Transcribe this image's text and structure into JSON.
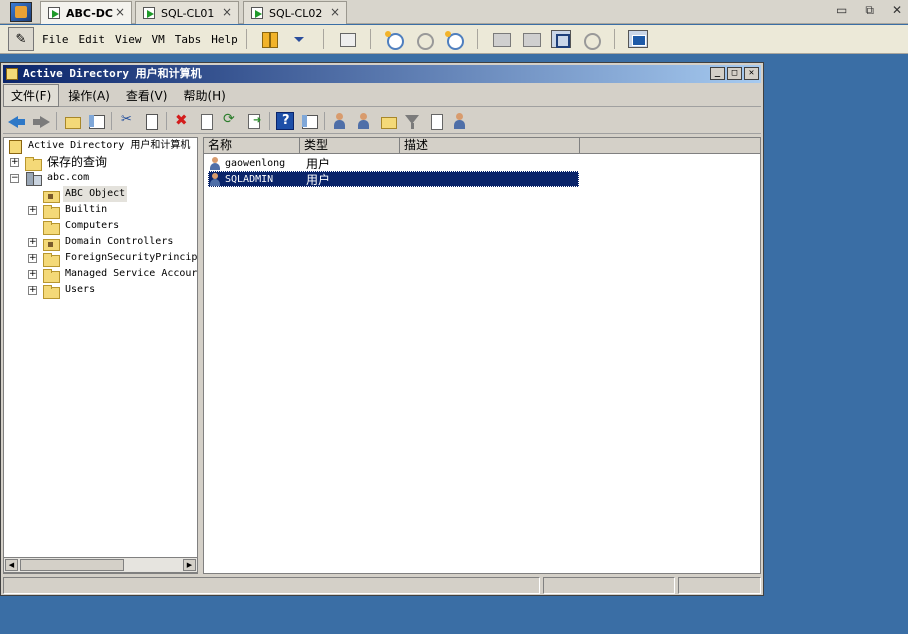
{
  "host": {
    "tabs": [
      {
        "label": "ABC-DC",
        "active": true
      },
      {
        "label": "SQL-CL01",
        "active": false
      },
      {
        "label": "SQL-CL02",
        "active": false
      }
    ],
    "tab_close_glyph": "×",
    "window_controls": [
      "▭",
      "⧉",
      "✕"
    ],
    "menu": [
      "File",
      "Edit",
      "View",
      "VM",
      "Tabs",
      "Help"
    ]
  },
  "mmc": {
    "title": "Active Directory 用户和计算机",
    "window_controls": [
      "_",
      "□",
      "✕"
    ],
    "menu": [
      {
        "label": "文件(F)",
        "open": true
      },
      {
        "label": "操作(A)",
        "open": false
      },
      {
        "label": "查看(V)",
        "open": false
      },
      {
        "label": "帮助(H)",
        "open": false
      }
    ]
  },
  "tree": {
    "root": "Active Directory 用户和计算机",
    "items": [
      {
        "label": "保存的查询",
        "expander": "+",
        "icon": "folder-icon",
        "depth": 0
      },
      {
        "label": "abc.com",
        "expander": "−",
        "icon": "domain-icon",
        "depth": 0
      },
      {
        "label": "ABC Object",
        "expander": "",
        "icon": "ou-icon",
        "depth": 1,
        "selected": true
      },
      {
        "label": "Builtin",
        "expander": "+",
        "icon": "folder-icon",
        "depth": 1
      },
      {
        "label": "Computers",
        "expander": "",
        "icon": "folder-icon",
        "depth": 1
      },
      {
        "label": "Domain Controllers",
        "expander": "+",
        "icon": "ou-icon",
        "depth": 1
      },
      {
        "label": "ForeignSecurityPrincip",
        "expander": "+",
        "icon": "folder-icon",
        "depth": 1
      },
      {
        "label": "Managed Service Accour",
        "expander": "+",
        "icon": "folder-icon",
        "depth": 1
      },
      {
        "label": "Users",
        "expander": "+",
        "icon": "folder-icon",
        "depth": 1
      }
    ]
  },
  "list": {
    "columns": [
      "名称",
      "类型",
      "描述"
    ],
    "rows": [
      {
        "name": "gaowenlong",
        "type": "用户",
        "description": "",
        "selected": false
      },
      {
        "name": "SQLADMIN",
        "type": "用户",
        "description": "",
        "selected": true
      }
    ]
  },
  "scroll_arrows": {
    "left": "◀",
    "right": "▶"
  },
  "colors": {
    "desktop": "#3a6ea5",
    "title_start": "#0a246a",
    "selection": "#0a246a"
  }
}
